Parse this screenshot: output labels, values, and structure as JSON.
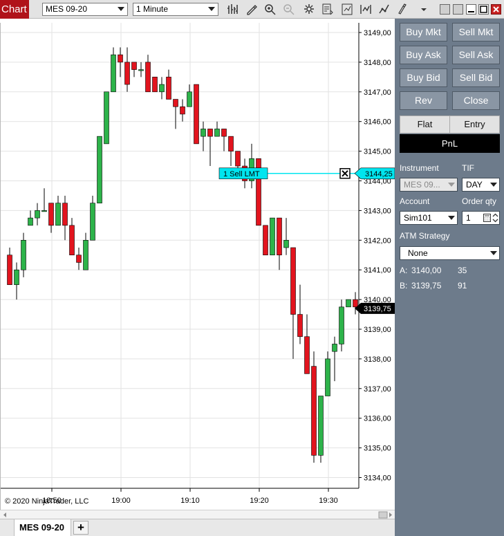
{
  "toolbar": {
    "chart_tab": "Chart",
    "instrument": "MES 09-20",
    "interval": "1 Minute"
  },
  "chart": {
    "copyright": "© 2020 NinjaTrader, LLC",
    "price_labels": [
      "3149,00",
      "3148,00",
      "3147,00",
      "3146,00",
      "3145,00",
      "3144,00",
      "3143,00",
      "3142,00",
      "3141,00",
      "3140,00",
      "3139,00",
      "3138,00",
      "3137,00",
      "3136,00",
      "3135,00",
      "3134,00"
    ],
    "time_labels": [
      "18:50",
      "19:00",
      "19:10",
      "19:20",
      "19:30"
    ],
    "last_price_label": "3139,75",
    "order_label": "1  Sell LMT",
    "order_price_label": "3144,25",
    "colors": {
      "up": "#2db34a",
      "down": "#e2141e",
      "order": "#00e5ef",
      "grid": "#e2e2e2"
    }
  },
  "chart_data": {
    "type": "candlestick",
    "ylim": [
      3134,
      3149.5
    ],
    "y_unit_ticks": [
      "3149,00",
      "3148,00",
      "3147,00",
      "3146,00",
      "3145,00",
      "3144,00",
      "3143,00",
      "3142,00",
      "3141,00",
      "3140,00",
      "3139,00",
      "3138,00",
      "3137,00",
      "3136,00",
      "3135,00",
      "3134,00"
    ],
    "x_ticks": [
      "18:50",
      "19:00",
      "19:10",
      "19:20",
      "19:30"
    ],
    "candles": [
      {
        "o": 3141.5,
        "h": 3141.75,
        "c": 3140.5,
        "l": 3140.5
      },
      {
        "o": 3140.5,
        "h": 3141.25,
        "c": 3141.0,
        "l": 3140.0
      },
      {
        "o": 3141.0,
        "h": 3142.25,
        "c": 3142.0,
        "l": 3140.75
      },
      {
        "o": 3142.5,
        "h": 3143.0,
        "c": 3142.75,
        "l": 3142.5
      },
      {
        "o": 3142.75,
        "h": 3143.25,
        "c": 3143.0,
        "l": 3142.5
      },
      {
        "o": 3143.0,
        "h": 3143.75,
        "c": 3143.0,
        "l": 3143.0
      },
      {
        "o": 3143.25,
        "h": 3143.25,
        "c": 3142.5,
        "l": 3142.25
      },
      {
        "o": 3142.5,
        "h": 3143.5,
        "c": 3143.25,
        "l": 3142.5
      },
      {
        "o": 3143.25,
        "h": 3143.5,
        "c": 3142.5,
        "l": 3142.0
      },
      {
        "o": 3142.5,
        "h": 3142.75,
        "c": 3141.5,
        "l": 3141.5
      },
      {
        "o": 3141.5,
        "h": 3141.75,
        "c": 3141.25,
        "l": 3141.0
      },
      {
        "o": 3141.0,
        "h": 3142.25,
        "c": 3142.0,
        "l": 3141.0
      },
      {
        "o": 3142.0,
        "h": 3143.5,
        "c": 3143.25,
        "l": 3142.0
      },
      {
        "o": 3143.25,
        "h": 3145.5,
        "c": 3145.5,
        "l": 3143.25
      },
      {
        "o": 3145.25,
        "h": 3147.0,
        "c": 3147.0,
        "l": 3145.25
      },
      {
        "o": 3147.0,
        "h": 3148.5,
        "c": 3148.25,
        "l": 3147.0
      },
      {
        "o": 3148.25,
        "h": 3148.5,
        "c": 3148.0,
        "l": 3147.5
      },
      {
        "o": 3148.0,
        "h": 3148.5,
        "c": 3147.25,
        "l": 3147.0
      },
      {
        "o": 3148.0,
        "h": 3148.0,
        "c": 3147.75,
        "l": 3147.5
      },
      {
        "o": 3147.75,
        "h": 3148.0,
        "c": 3147.75,
        "l": 3147.5
      },
      {
        "o": 3148.0,
        "h": 3148.25,
        "c": 3147.0,
        "l": 3147.0
      },
      {
        "o": 3147.5,
        "h": 3147.5,
        "c": 3147.0,
        "l": 3147.0
      },
      {
        "o": 3147.0,
        "h": 3147.5,
        "c": 3147.25,
        "l": 3146.75
      },
      {
        "o": 3147.5,
        "h": 3147.75,
        "c": 3146.75,
        "l": 3146.75
      },
      {
        "o": 3146.75,
        "h": 3146.75,
        "c": 3146.5,
        "l": 3145.75
      },
      {
        "o": 3146.5,
        "h": 3146.75,
        "c": 3146.25,
        "l": 3146.0
      },
      {
        "o": 3146.5,
        "h": 3147.25,
        "c": 3147.0,
        "l": 3146.5
      },
      {
        "o": 3147.25,
        "h": 3147.25,
        "c": 3145.25,
        "l": 3145.25
      },
      {
        "o": 3145.5,
        "h": 3146.0,
        "c": 3145.75,
        "l": 3145.0
      },
      {
        "o": 3145.75,
        "h": 3145.75,
        "c": 3145.5,
        "l": 3144.5
      },
      {
        "o": 3145.5,
        "h": 3146.0,
        "c": 3145.75,
        "l": 3145.5
      },
      {
        "o": 3145.75,
        "h": 3145.75,
        "c": 3145.5,
        "l": 3145.0
      },
      {
        "o": 3145.5,
        "h": 3145.5,
        "c": 3145.0,
        "l": 3144.5
      },
      {
        "o": 3145.0,
        "h": 3145.0,
        "c": 3144.5,
        "l": 3144.25
      },
      {
        "o": 3144.5,
        "h": 3144.75,
        "c": 3144.0,
        "l": 3143.75
      },
      {
        "o": 3144.0,
        "h": 3145.25,
        "c": 3144.75,
        "l": 3143.75
      },
      {
        "o": 3144.75,
        "h": 3144.75,
        "c": 3142.5,
        "l": 3142.5
      },
      {
        "o": 3142.5,
        "h": 3142.5,
        "c": 3141.5,
        "l": 3141.5
      },
      {
        "o": 3141.5,
        "h": 3142.75,
        "c": 3142.75,
        "l": 3141.5
      },
      {
        "o": 3142.75,
        "h": 3142.75,
        "c": 3141.5,
        "l": 3141.0
      },
      {
        "o": 3141.75,
        "h": 3142.75,
        "c": 3142.0,
        "l": 3141.5
      },
      {
        "o": 3141.75,
        "h": 3141.75,
        "c": 3139.5,
        "l": 3138.0
      },
      {
        "o": 3139.5,
        "h": 3140.5,
        "c": 3138.75,
        "l": 3138.5
      },
      {
        "o": 3138.75,
        "h": 3139.5,
        "c": 3137.5,
        "l": 3137.5
      },
      {
        "o": 3137.75,
        "h": 3138.25,
        "c": 3134.75,
        "l": 3134.5
      },
      {
        "o": 3134.75,
        "h": 3136.75,
        "c": 3136.75,
        "l": 3134.5
      },
      {
        "o": 3136.75,
        "h": 3138.25,
        "c": 3138.0,
        "l": 3136.75
      },
      {
        "o": 3138.25,
        "h": 3138.75,
        "c": 3138.5,
        "l": 3137.25
      },
      {
        "o": 3138.5,
        "h": 3140.0,
        "c": 3139.75,
        "l": 3138.25
      },
      {
        "o": 3139.75,
        "h": 3140.0,
        "c": 3140.0,
        "l": 3139.75
      },
      {
        "o": 3140.0,
        "h": 3140.25,
        "c": 3139.75,
        "l": 3139.5
      }
    ]
  },
  "panel": {
    "buy_mkt": "Buy Mkt",
    "sell_mkt": "Sell Mkt",
    "buy_ask": "Buy Ask",
    "sell_ask": "Sell Ask",
    "buy_bid": "Buy Bid",
    "sell_bid": "Sell Bid",
    "rev": "Rev",
    "close": "Close",
    "flat": "Flat",
    "entry": "Entry",
    "pnl": "PnL",
    "instrument_label": "Instrument",
    "tif_label": "TIF",
    "instrument_value": "MES 09...",
    "tif_value": "DAY",
    "account_label": "Account",
    "order_qty_label": "Order qty",
    "account_value": "Sim101",
    "order_qty_value": "1",
    "atm_label": "ATM Strategy",
    "atm_value": "None",
    "ask_label": "A:",
    "ask_price": "3140,00",
    "ask_size": "35",
    "bid_label": "B:",
    "bid_price": "3139,75",
    "bid_size": "91"
  },
  "bottom": {
    "instrument_tab": "MES 09-20",
    "add_tab": "+"
  }
}
